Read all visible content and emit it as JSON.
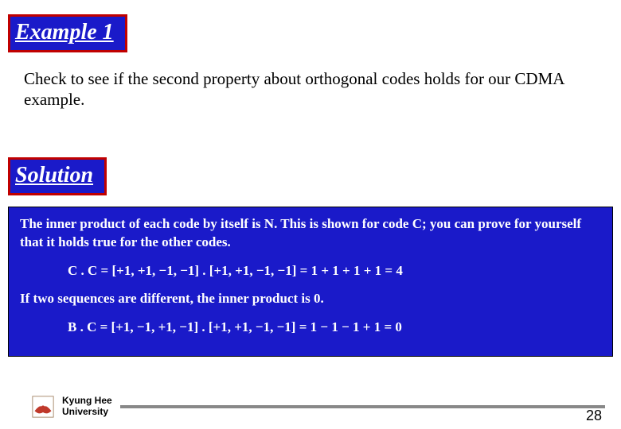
{
  "titles": {
    "example": "Example 1",
    "solution": "Solution"
  },
  "problem": "Check to see if the second property about orthogonal codes holds for our CDMA example.",
  "content": {
    "p1": "The inner product of each code by itself is N. This is shown for code C; you can prove for yourself that it holds true for the other codes.",
    "eq1": "C . C = [+1, +1, −1, −1] . [+1, +1, −1, −1] = 1 + 1 + 1 + 1 = 4",
    "p2": "If two sequences are different, the inner product is 0.",
    "eq2": "B . C = [+1, −1, +1, −1] . [+1, +1, −1, −1] = 1 − 1 − 1 + 1 = 0"
  },
  "footer": {
    "university_line1": "Kyung Hee",
    "university_line2": "University",
    "page": "28"
  }
}
